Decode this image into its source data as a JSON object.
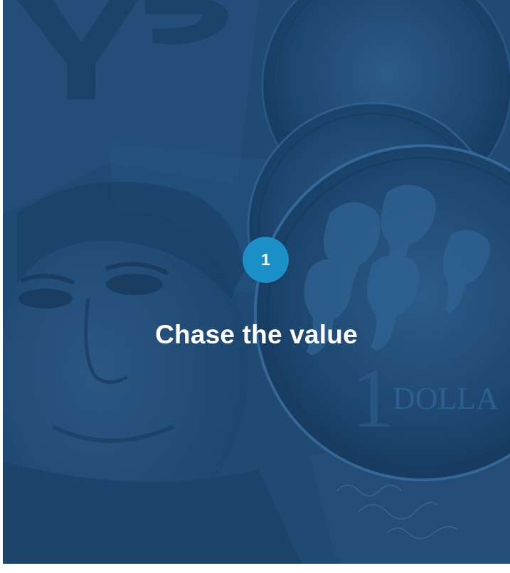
{
  "step": {
    "number": "1",
    "title": "Chase the value"
  },
  "background": {
    "description_icon": "banknote-and-coins-image",
    "coin_inscription": "DOLLA",
    "colors": {
      "overlay": "#1f4a74",
      "badge": "#1a8fc8",
      "text": "#ffffff"
    }
  }
}
